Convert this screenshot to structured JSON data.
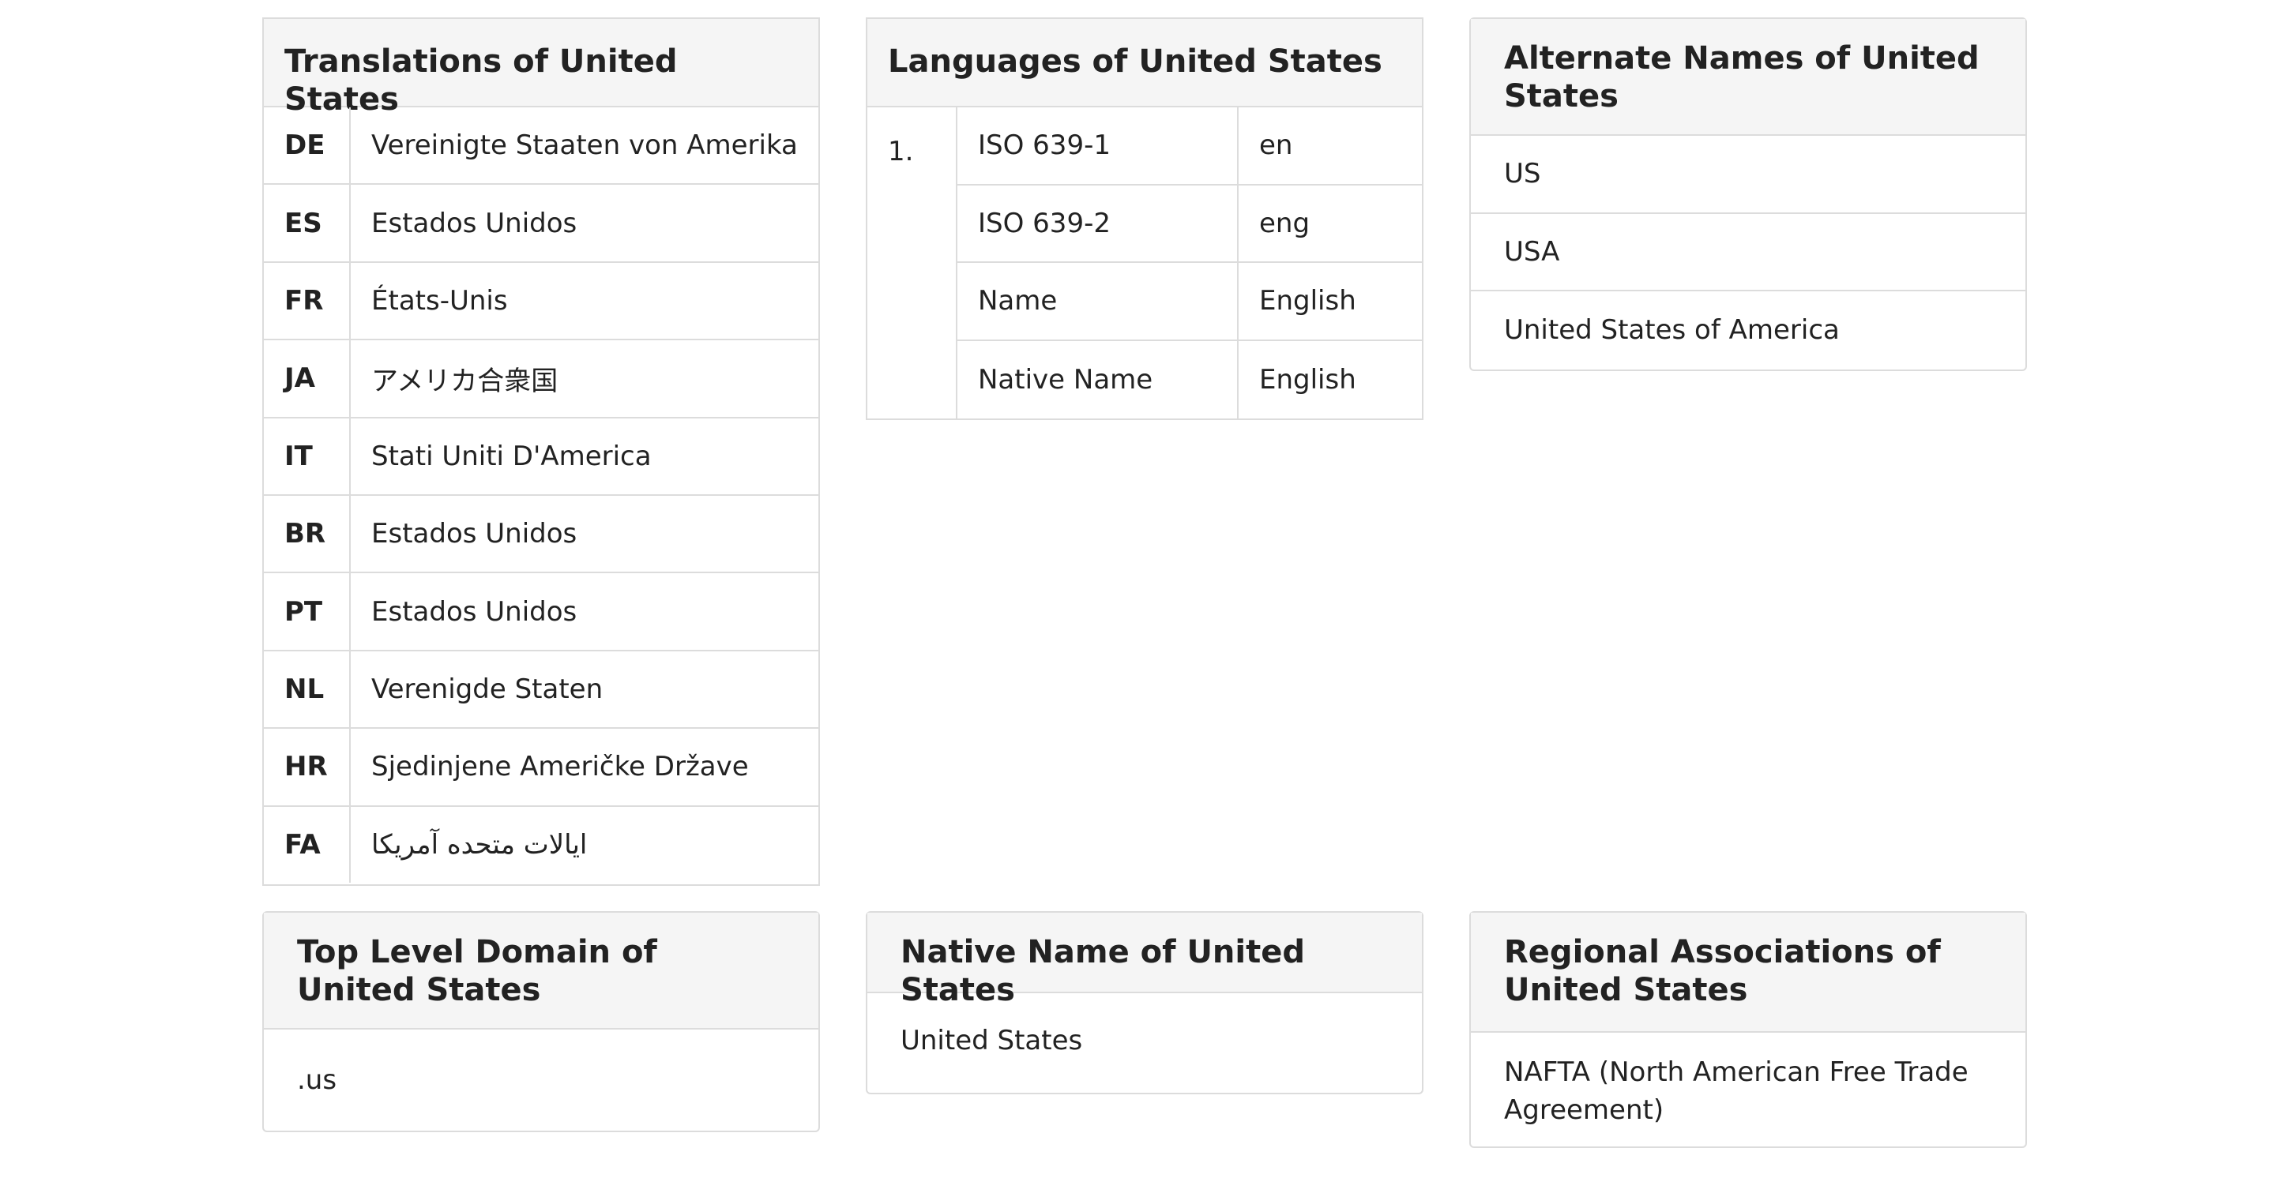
{
  "translations": {
    "title": "Translations of United States",
    "rows": [
      {
        "code": "DE",
        "name": "Vereinigte Staaten von Amerika"
      },
      {
        "code": "ES",
        "name": "Estados Unidos"
      },
      {
        "code": "FR",
        "name": "États-Unis"
      },
      {
        "code": "JA",
        "name": "アメリカ合衆国"
      },
      {
        "code": "IT",
        "name": "Stati Uniti D'America"
      },
      {
        "code": "BR",
        "name": "Estados Unidos"
      },
      {
        "code": "PT",
        "name": "Estados Unidos"
      },
      {
        "code": "NL",
        "name": "Verenigde Staten"
      },
      {
        "code": "HR",
        "name": "Sjedinjene Američke Države"
      },
      {
        "code": "FA",
        "name": "ایالات متحده آمریکا"
      }
    ]
  },
  "languages": {
    "title": "Languages of United States",
    "index": "1.",
    "rows": [
      {
        "key": "ISO 639-1",
        "value": "en"
      },
      {
        "key": "ISO 639-2",
        "value": "eng"
      },
      {
        "key": "Name",
        "value": "English"
      },
      {
        "key": "Native Name",
        "value": "English"
      }
    ]
  },
  "alternate_names": {
    "title": "Alternate Names of United States",
    "items": [
      "US",
      "USA",
      "United States of America"
    ]
  },
  "top_level_domain": {
    "title": "Top Level Domain of United States",
    "value": ".us"
  },
  "native_name": {
    "title": "Native Name of United States",
    "value": "United States"
  },
  "regional_associations": {
    "title": "Regional Associations of United States",
    "items": [
      "NAFTA (North American Free Trade Agreement)"
    ]
  }
}
